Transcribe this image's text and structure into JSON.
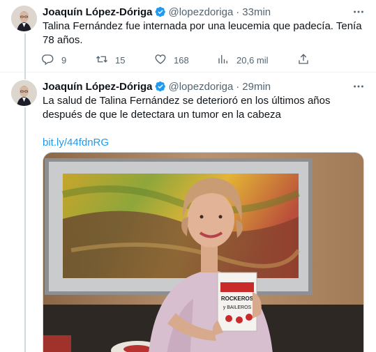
{
  "tweets": [
    {
      "author_name": "Joaquín López-Dóriga",
      "handle": "@lopezdoriga",
      "separator": "·",
      "time": "33min",
      "text": "Talina Fernández fue internada por una leucemia que padecía. Tenía 78 años.",
      "replies": "9",
      "retweets": "15",
      "likes": "168",
      "views": "20,6 mil"
    },
    {
      "author_name": "Joaquín López-Dóriga",
      "handle": "@lopezdoriga",
      "separator": "·",
      "time": "29min",
      "text": "La salud de Talina Fernández se deterioró en los últimos años después de que le detectara un tumor en la cabeza",
      "link": "bit.ly/44fdnRG"
    }
  ],
  "media": {
    "book_cover_text": "ROCKEROS y BAILEROS VOL. 1"
  },
  "colors": {
    "link": "#1d9bf0",
    "verified_badge": "#1d9bf0",
    "secondary_text": "#536471"
  },
  "icons": [
    "verified-badge-icon",
    "more-icon",
    "reply-icon",
    "retweet-icon",
    "like-icon",
    "views-icon",
    "share-icon"
  ]
}
